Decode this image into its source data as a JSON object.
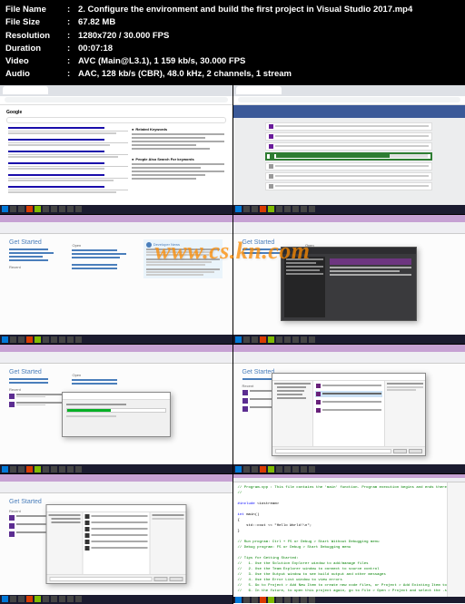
{
  "header": {
    "labels": {
      "filename": "File Name",
      "filesize": "File Size",
      "resolution": "Resolution",
      "duration": "Duration",
      "video": "Video",
      "audio": "Audio"
    },
    "filename": "2. Configure the environment and build the first project in Visual Studio 2017.mp4",
    "filesize": "67.82 MB",
    "resolution": "1280x720 / 30.000 FPS",
    "duration": "00:07:18",
    "video": "AVC (Main@L3.1), 1 159 kb/s, 30.000 FPS",
    "audio": "AAC, 128 kb/s (CBR), 48.0 kHz, 2 channels, 1 stream"
  },
  "watermark": "www.cs.kn.com",
  "google": {
    "logo": "Google",
    "side1": "Related Keywords",
    "side2": "People Also Search For keywords"
  },
  "vs": {
    "get_started": "Get Started",
    "open": "Open",
    "recent": "Recent",
    "dev_news": "Developer News"
  }
}
